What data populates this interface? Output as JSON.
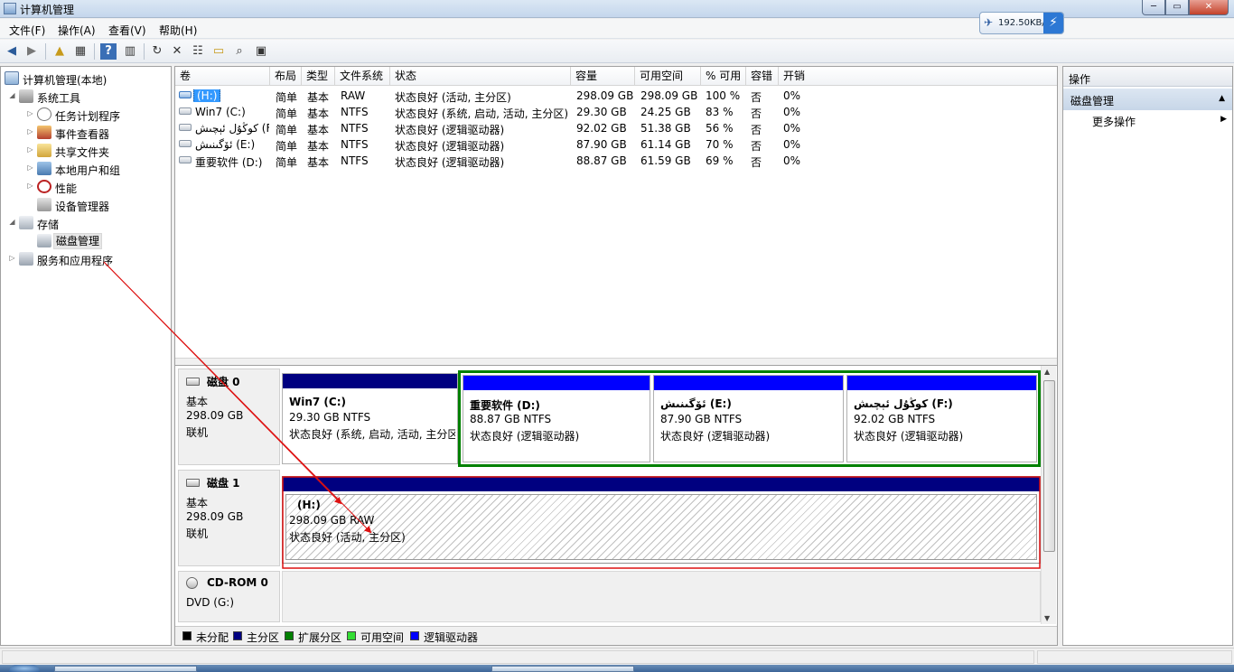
{
  "window": {
    "title": "计算机管理"
  },
  "net_widget": {
    "speed": "192.50KB/s"
  },
  "window_buttons": {
    "minimize": "─",
    "maximize": "▭",
    "close": "✕"
  },
  "menu": [
    "文件(F)",
    "操作(A)",
    "查看(V)",
    "帮助(H)"
  ],
  "tree": {
    "root": "计算机管理(本地)",
    "system_tools": "系统工具",
    "task_scheduler": "任务计划程序",
    "event_viewer": "事件查看器",
    "shared_folders": "共享文件夹",
    "local_users": "本地用户和组",
    "performance": "性能",
    "device_manager": "设备管理器",
    "storage": "存储",
    "disk_management": "磁盘管理",
    "services_apps": "服务和应用程序"
  },
  "volume_list": {
    "headers": [
      "卷",
      "布局",
      "类型",
      "文件系统",
      "状态",
      "容量",
      "可用空间",
      "% 可用",
      "容错",
      "开销"
    ],
    "rows": [
      [
        "(H:)",
        "简单",
        "基本",
        "RAW",
        "状态良好 (活动, 主分区)",
        "298.09 GB",
        "298.09 GB",
        "100 %",
        "否",
        "0%"
      ],
      [
        "Win7 (C:)",
        "简单",
        "基本",
        "NTFS",
        "状态良好 (系统, 启动, 活动, 主分区)",
        "29.30 GB",
        "24.25 GB",
        "83 %",
        "否",
        "0%"
      ],
      [
        "كوڭۇل ئېچىش (F:)",
        "简单",
        "基本",
        "NTFS",
        "状态良好 (逻辑驱动器)",
        "92.02 GB",
        "51.38 GB",
        "56 %",
        "否",
        "0%"
      ],
      [
        "ئۆگىنىش (E:)",
        "简单",
        "基本",
        "NTFS",
        "状态良好 (逻辑驱动器)",
        "87.90 GB",
        "61.14 GB",
        "70 %",
        "否",
        "0%"
      ],
      [
        "重要软件 (D:)",
        "简单",
        "基本",
        "NTFS",
        "状态良好 (逻辑驱动器)",
        "88.87 GB",
        "61.59 GB",
        "69 %",
        "否",
        "0%"
      ]
    ]
  },
  "disks": [
    {
      "title": "磁盘 0",
      "type": "基本",
      "size": "298.09 GB",
      "status": "联机",
      "partitions": [
        {
          "name": "Win7  (C:)",
          "size": "29.30 GB NTFS",
          "status": "状态良好 (系统, 启动, 活动, 主分区)"
        },
        {
          "name": "重要软件  (D:)",
          "size": "88.87 GB NTFS",
          "status": "状态良好 (逻辑驱动器)"
        },
        {
          "name": "ئۆگىنىش  (E:)",
          "size": "87.90 GB NTFS",
          "status": "状态良好 (逻辑驱动器)"
        },
        {
          "name": "كوڭۇل ئېچىش   (F:)",
          "size": "92.02 GB NTFS",
          "status": "状态良好 (逻辑驱动器)"
        }
      ]
    },
    {
      "title": "磁盘 1",
      "type": "基本",
      "size": "298.09 GB",
      "status": "联机",
      "partitions": [
        {
          "name": "(H:)",
          "size": "298.09 GB RAW",
          "status": "状态良好 (活动, 主分区)"
        }
      ]
    },
    {
      "title": "CD-ROM 0",
      "type": "DVD (G:)"
    }
  ],
  "legend": [
    {
      "label": "未分配",
      "color": "#000000"
    },
    {
      "label": "主分区",
      "color": "#000080"
    },
    {
      "label": "扩展分区",
      "color": "#008000"
    },
    {
      "label": "可用空间",
      "color": "#33dd33"
    },
    {
      "label": "逻辑驱动器",
      "color": "#0000ff"
    }
  ],
  "actions": {
    "header": "操作",
    "section": "磁盘管理",
    "more": "更多操作"
  },
  "colors": {
    "primary_bar": "#000080",
    "logical_bar": "#0000ff",
    "extended_border": "#008000",
    "annotation": "#dd1111",
    "selection": "#3399ff"
  }
}
